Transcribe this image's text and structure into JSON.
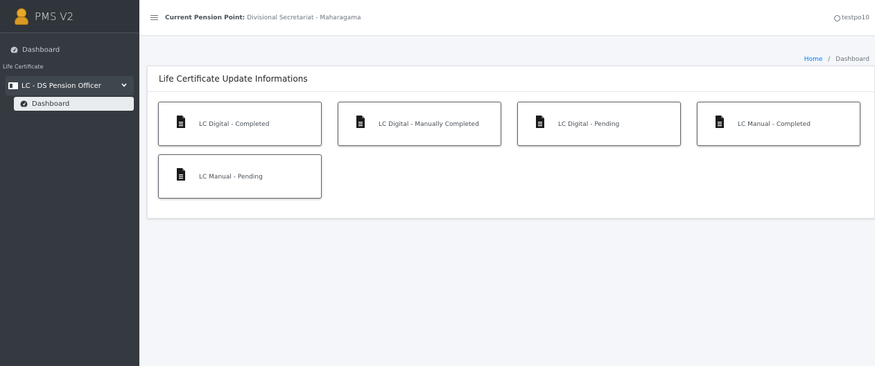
{
  "brand": {
    "name": "PMS V2"
  },
  "sidebar": {
    "dashboard_label": "Dashboard",
    "section_header": "Life Certificate",
    "group_label": "LC - DS Pension Officer",
    "sub_items": [
      {
        "label": "Dashboard"
      }
    ]
  },
  "topbar": {
    "pension_point_label": "Current Pension Point:",
    "pension_point_value": "Divisional Secretariat - Maharagama",
    "user_name": "testpo10"
  },
  "breadcrumb": {
    "home": "Home",
    "separator": "/",
    "current": "Dashboard"
  },
  "card": {
    "title": "Life Certificate Update Informations",
    "tiles": [
      {
        "label": "LC Digital - Completed"
      },
      {
        "label": "LC Digital - Manually Completed"
      },
      {
        "label": "LC Digital - Pending"
      },
      {
        "label": "LC Manual - Completed"
      },
      {
        "label": "LC Manual - Pending"
      }
    ]
  },
  "colors": {
    "sidebar_bg": "#343a40",
    "content_bg": "#f4f6f9",
    "link": "#007bff"
  }
}
